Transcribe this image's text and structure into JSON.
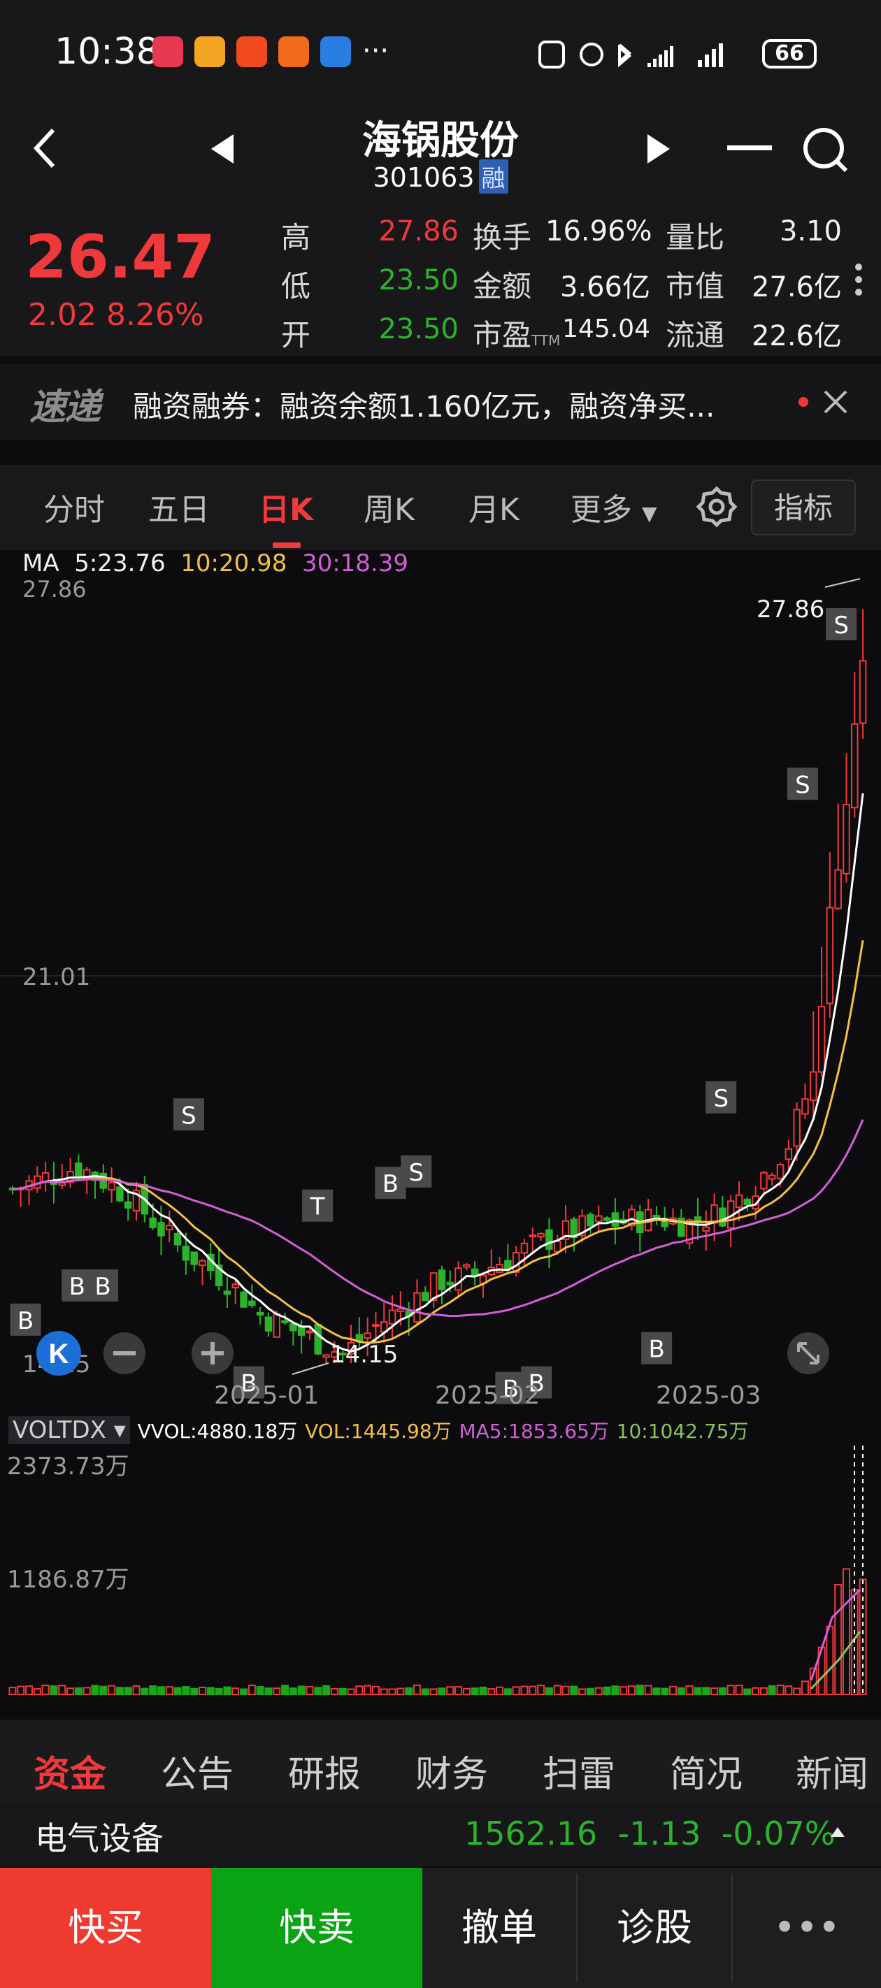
{
  "status_bar": {
    "time": "10:38",
    "more": "···",
    "battery": "66",
    "app_icons": [
      "huawei-app-icon",
      "orange-app-icon",
      "taobao-app-icon",
      "alipay-app-icon",
      "blue-app-icon"
    ]
  },
  "header": {
    "name": "海锅股份",
    "code": "301063",
    "badge": "融"
  },
  "quote": {
    "price": "26.47",
    "change": "2.02 8.26%",
    "rows": [
      {
        "l1": "高",
        "v1": "27.86",
        "c1": "#f0393a",
        "l2": "换手",
        "v2": "16.96%",
        "l3": "量比",
        "v3": "3.10"
      },
      {
        "l1": "低",
        "v1": "23.50",
        "c1": "#2bb32b",
        "l2": "金额",
        "v2": "3.66亿",
        "l3": "市值",
        "v3": "27.6亿"
      },
      {
        "l1": "开",
        "v1": "23.50",
        "c1": "#2bb32b",
        "l2": "市盈",
        "v2": "145.04",
        "l3": "流通",
        "v3": "22.6亿"
      }
    ],
    "ttm": "TTM"
  },
  "news": {
    "logo": "速递",
    "text": "融资融券：融资余额1.160亿元，融资净买..."
  },
  "tabs": [
    "分时",
    "五日",
    "日K",
    "周K",
    "月K",
    "更多"
  ],
  "active_tab": "日K",
  "indicator_button": "指标",
  "ma": {
    "label": "MA",
    "ma5": "5:23.76",
    "ma10": "10:20.98",
    "ma30": "30:18.39",
    "colors": {
      "ma5": "#ffffff",
      "ma10": "#f5c042",
      "ma30": "#d35fd8"
    }
  },
  "chart_data": {
    "type": "candlestick",
    "y_labels": [
      "27.86",
      "21.01",
      "14.15"
    ],
    "high_annotation": "27.86",
    "low_annotation": "14.15",
    "x_labels": [
      "2025-01",
      "2025-02",
      "2025-03"
    ],
    "ylim": [
      14.15,
      27.86
    ],
    "signals": [
      {
        "label": "B",
        "x": 0.02,
        "y": 14.9
      },
      {
        "label": "B",
        "x": 0.08,
        "y": 15.5
      },
      {
        "label": "B",
        "x": 0.11,
        "y": 15.5
      },
      {
        "label": "S",
        "x": 0.21,
        "y": 18.5
      },
      {
        "label": "T",
        "x": 0.36,
        "y": 16.9
      },
      {
        "label": "B",
        "x": 0.28,
        "y": 13.8
      },
      {
        "label": "B",
        "x": 0.445,
        "y": 17.3
      },
      {
        "label": "S",
        "x": 0.475,
        "y": 17.5
      },
      {
        "label": "B",
        "x": 0.585,
        "y": 13.7
      },
      {
        "label": "B",
        "x": 0.615,
        "y": 13.8
      },
      {
        "label": "B",
        "x": 0.755,
        "y": 14.4
      },
      {
        "label": "S",
        "x": 0.83,
        "y": 18.8
      },
      {
        "label": "S",
        "x": 0.925,
        "y": 24.3
      },
      {
        "label": "S",
        "x": 0.97,
        "y": 27.1
      }
    ],
    "volume": {
      "indicator": "VOLTDX",
      "vvol": "VVOL:4880.18万",
      "vol": "VOL:1445.98万",
      "ma5": "MA5:1853.65万",
      "ma10": "10:1042.75万",
      "y_labels": [
        "2373.73万",
        "1186.87万"
      ],
      "colors": {
        "vvol": "#ffffff",
        "vol": "#f5c042",
        "ma5": "#d35fd8",
        "ma10": "#8cc45a"
      }
    }
  },
  "footer_tabs": [
    "资金",
    "公告",
    "研报",
    "财务",
    "扫雷",
    "简况",
    "新闻"
  ],
  "active_footer_tab": "资金",
  "sector": {
    "name": "电气设备",
    "value": "1562.16",
    "change": "-1.13",
    "pct": "-0.07%"
  },
  "actions": {
    "buy": "快买",
    "sell": "快卖",
    "cancel": "撤单",
    "diagnose": "诊股",
    "more": "•••"
  }
}
